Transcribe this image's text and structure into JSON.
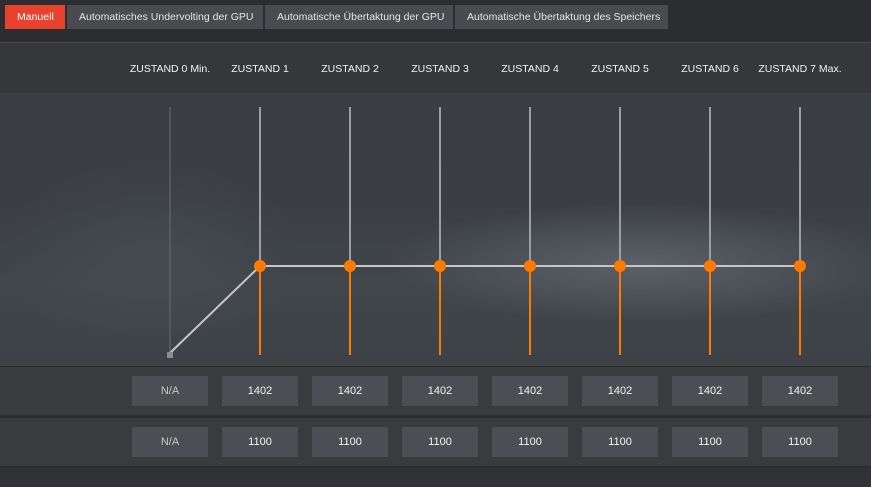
{
  "tabs": [
    {
      "label": "Manuell",
      "active": true
    },
    {
      "label": "Automatisches Undervolting der GPU",
      "active": false
    },
    {
      "label": "Automatische Übertaktung der GPU",
      "active": false
    },
    {
      "label": "Automatische Übertaktung des Speichers",
      "active": false
    }
  ],
  "states": [
    {
      "label": "ZUSTAND 0 Min.",
      "frequency": "N/A",
      "voltage": "N/A"
    },
    {
      "label": "ZUSTAND 1",
      "frequency": "1402",
      "voltage": "1100"
    },
    {
      "label": "ZUSTAND 2",
      "frequency": "1402",
      "voltage": "1100"
    },
    {
      "label": "ZUSTAND 3",
      "frequency": "1402",
      "voltage": "1100"
    },
    {
      "label": "ZUSTAND 4",
      "frequency": "1402",
      "voltage": "1100"
    },
    {
      "label": "ZUSTAND 5",
      "frequency": "1402",
      "voltage": "1100"
    },
    {
      "label": "ZUSTAND 6",
      "frequency": "1402",
      "voltage": "1100"
    },
    {
      "label": "ZUSTAND 7 Max.",
      "frequency": "1402",
      "voltage": "1100"
    }
  ],
  "colors": {
    "accent": "#e8412d",
    "point": "#ff7a00",
    "line": "#bfbfbf"
  }
}
